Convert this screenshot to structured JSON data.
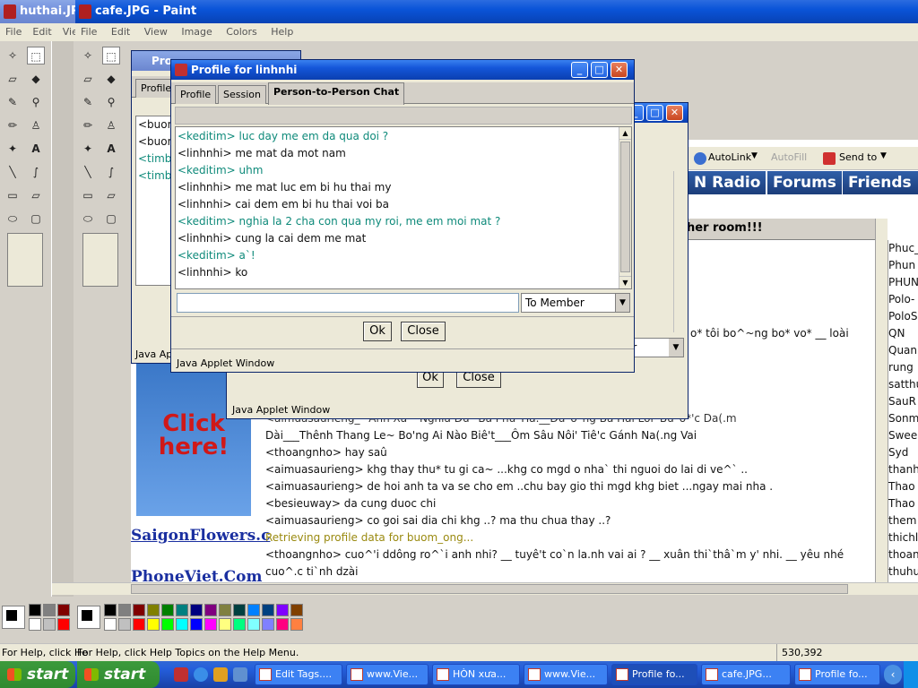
{
  "paint1": {
    "title": "huthai.JPG - Paint",
    "menu": [
      "File",
      "Edit",
      "View"
    ]
  },
  "paint2": {
    "title": "cafe.JPG - Paint",
    "menu": [
      "File",
      "Edit",
      "View",
      "Image",
      "Colors",
      "Help"
    ]
  },
  "status_bar": {
    "help_left": "For Help, click He",
    "help_main": "For Help, click Help Topics on the Help Menu.",
    "coords": "530,392"
  },
  "bg_window": {
    "title_fragment": "Pro",
    "tab_fragment": "Profile",
    "lines": [
      "<buom",
      "<buom",
      "<timba",
      "<timba"
    ],
    "applet_label": "Java Ap"
  },
  "second_dialog": {
    "ok": "Ok",
    "close": "Close",
    "applet_label": "Java Applet Window",
    "toolbar": {
      "autolink": "AutoLink",
      "autofill": "AutoFill",
      "sendto": "Send to"
    },
    "combo_fragment": "er"
  },
  "dialog": {
    "title": "Profile for linhnhi",
    "tabs": [
      "Profile",
      "Session",
      "Person-to-Person Chat"
    ],
    "chat": [
      {
        "text": "<keditim> luc day me em da qua doi ?",
        "style": "teal"
      },
      {
        "text": "<linhnhi>  me mat da mot nam",
        "style": "dark"
      },
      {
        "text": "<keditim> uhm",
        "style": "teal"
      },
      {
        "text": "<linhnhi>  me mat luc em bi hu thai my",
        "style": "dark"
      },
      {
        "text": "<linhnhi>  cai dem em bi hu thai voi ba",
        "style": "dark"
      },
      {
        "text": "<keditim> nghia la 2 cha con qua my roi, me em moi mat ?",
        "style": "teal"
      },
      {
        "text": "<linhnhi>  cung la cai dem me mat",
        "style": "dark"
      },
      {
        "text": "<keditim> a`!",
        "style": "teal"
      },
      {
        "text": "<linhnhi>  ko",
        "style": "dark"
      }
    ],
    "input_value": "",
    "recipient": "To Member",
    "ok": "Ok",
    "close": "Close",
    "applet_label": "Java Applet Window"
  },
  "web": {
    "nav": [
      "N Radio",
      "Forums",
      "Friends"
    ],
    "room_header": "her room!!!",
    "ad": {
      "line1": "Click",
      "line2": "here!"
    },
    "links": [
      "SaigonFlowers.c",
      "PhoneViet.Com"
    ],
    "room_lines": [
      {
        "text": "o* tôi  bo^~ng bo* vo* __ loài",
        "style": "dark"
      },
      {
        "text": "<aimuasaurieng_* Anh Xa~ Nghĩa Đu* Ba Phu`Ha.__Đu*o*ng Ba Hai Lôi' Bu*o*'c Da(.m",
        "style": "dark"
      },
      {
        "text": "   Dài___Thênh Thang Le~ Bo'ng Ai Nào Biê't___Ôm Sâu Nôi' Tiê'c Gánh Na(.ng Vai",
        "style": "dark"
      },
      {
        "text": "<thoangnho> hay saû",
        "style": "dark"
      },
      {
        "text": "<aimuasaurieng> khg    thay thu*  tu  gi ca~ ...khg co mgd  o nha`  thi  nguoi do lai di ve^`  ..",
        "style": "dark"
      },
      {
        "text": "<aimuasaurieng> de    hoi anh ta  va  se  cho em   ..chu bay gio thi mgd  khg biet   ...ngay mai  nha  .",
        "style": "dark"
      },
      {
        "text": "<besieuway> da cung duoc chi",
        "style": "dark"
      },
      {
        "text": "<aimuasaurieng> co goi sai dia chi khg ..? ma  thu  chua thay ..?",
        "style": "dark"
      },
      {
        "text": "Retrieving profile data for buom_ong...",
        "style": "olive"
      },
      {
        "text": "<thoangnho> cuo^'i ddông ro^`i anh nhi? __ tuyê't co`n  la.nh  vai ai ? __  xuân thi`thâ`m y' nhi. __ yêu nhé",
        "style": "dark"
      },
      {
        "text": "   cuo^.c ti`nh dzài",
        "style": "dark"
      }
    ],
    "users": [
      "Phuc_",
      "Phun",
      "PHUN",
      "Polo-",
      "PoloS",
      "QN",
      "Quan",
      "rung",
      "satthu",
      "SauR",
      "Sonm",
      "Swee",
      "Syd",
      "thanh",
      "Thao",
      "Thao",
      "them",
      "thichl",
      "thoan",
      "thuhu"
    ]
  },
  "taskbar": {
    "start1": "start",
    "start2": "start",
    "tasks": [
      "Edit Tags....",
      "www.Vie...",
      "HÒN xưa...",
      "www.Vie...",
      "Profile fo...",
      "cafe.JPG...",
      "Profile fo..."
    ]
  },
  "colors": {
    "title_blue": "#0a54d8",
    "teal_text": "#0e8a7a",
    "olive_text": "#9a8a10",
    "nav_blue": "#1c3d7a"
  }
}
